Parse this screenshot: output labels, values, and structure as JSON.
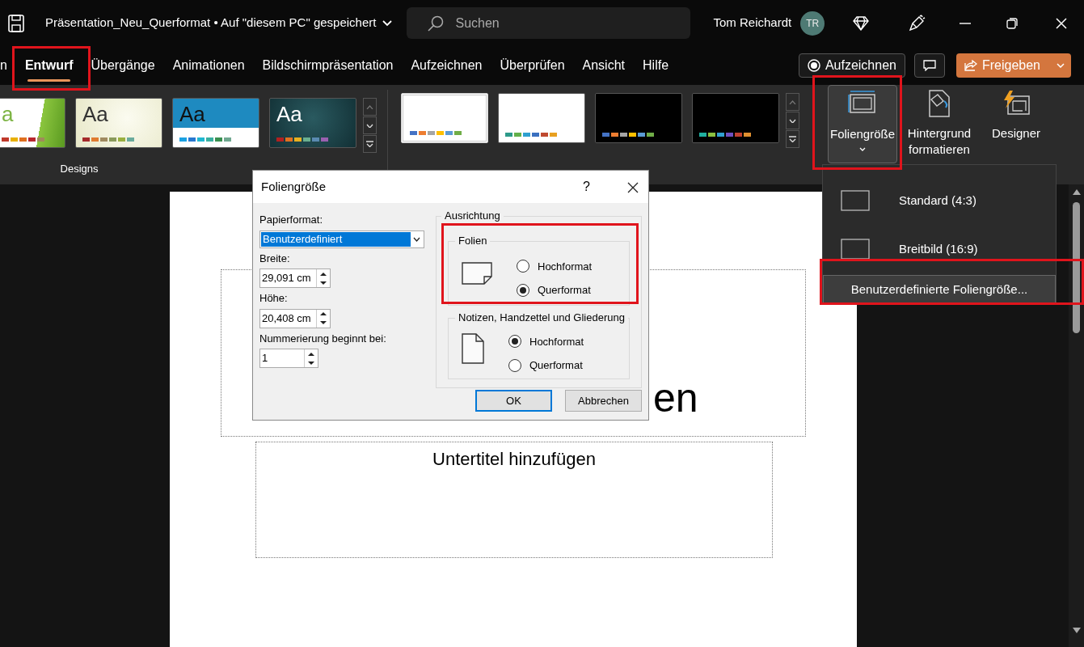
{
  "title_bar": {
    "document_title": "Präsentation_Neu_Querformat • Auf \"diesem PC\" gespeichert",
    "search_placeholder": "Suchen",
    "user_name": "Tom Reichardt",
    "avatar_initials": "TR"
  },
  "tabs": [
    {
      "label": "n",
      "selected": false
    },
    {
      "label": "Entwurf",
      "selected": true
    },
    {
      "label": "Übergänge",
      "selected": false
    },
    {
      "label": "Animationen",
      "selected": false
    },
    {
      "label": "Bildschirmpräsentation",
      "selected": false
    },
    {
      "label": "Aufzeichnen",
      "selected": false
    },
    {
      "label": "Überprüfen",
      "selected": false
    },
    {
      "label": "Ansicht",
      "selected": false
    },
    {
      "label": "Hilfe",
      "selected": false
    }
  ],
  "tab_actions": {
    "record": "Aufzeichnen",
    "share": "Freigeben"
  },
  "ribbon": {
    "designs": {
      "label": "Designs",
      "items": [
        {
          "kind": "green",
          "text": "a",
          "swatches": [
            {
              "color": "#c0392b"
            },
            {
              "color": "#e8b000"
            },
            {
              "color": "#e07020"
            },
            {
              "color": "#b8262e"
            },
            {
              "color": "#a08a5a"
            }
          ]
        },
        {
          "kind": "cream",
          "text": "Aa",
          "swatches": [
            {
              "color": "#a52a2a"
            },
            {
              "color": "#e07b30"
            },
            {
              "color": "#a08a60"
            },
            {
              "color": "#8a9a5b"
            },
            {
              "color": "#9ab040"
            },
            {
              "color": "#6aab9c"
            }
          ]
        },
        {
          "kind": "pattern",
          "text": "Aa",
          "swatches": [
            {
              "color": "#1ba1e2"
            },
            {
              "color": "#2878d0"
            },
            {
              "color": "#20b8d0"
            },
            {
              "color": "#3ab0a0"
            },
            {
              "color": "#3a9050"
            },
            {
              "color": "#70a890"
            }
          ]
        },
        {
          "kind": "teal",
          "text": "Aa",
          "swatches": [
            {
              "color": "#b02020"
            },
            {
              "color": "#e07020"
            },
            {
              "color": "#e8b020"
            },
            {
              "color": "#6ab090"
            },
            {
              "color": "#5a8ab0"
            },
            {
              "color": "#9a60b0"
            }
          ]
        }
      ]
    },
    "variants": [
      {
        "kind": "light",
        "selected": true,
        "swatches": [
          {
            "color": "#4472c4"
          },
          {
            "color": "#ed7d31"
          },
          {
            "color": "#a5a5a5"
          },
          {
            "color": "#ffc000"
          },
          {
            "color": "#5b9bd5"
          },
          {
            "color": "#70ad47"
          }
        ]
      },
      {
        "kind": "light",
        "selected": false,
        "swatches": [
          {
            "color": "#2e9a8a"
          },
          {
            "color": "#62b04a"
          },
          {
            "color": "#2ea0d0"
          },
          {
            "color": "#3a70c0"
          },
          {
            "color": "#c04a30"
          },
          {
            "color": "#e8a020"
          }
        ]
      },
      {
        "kind": "dark",
        "selected": false,
        "swatches": [
          {
            "color": "#4472c4"
          },
          {
            "color": "#ed7d31"
          },
          {
            "color": "#a5a5a5"
          },
          {
            "color": "#ffc000"
          },
          {
            "color": "#5b9bd5"
          },
          {
            "color": "#70ad47"
          }
        ]
      },
      {
        "kind": "dark",
        "selected": false,
        "swatches": [
          {
            "color": "#20b0a0"
          },
          {
            "color": "#8ac040"
          },
          {
            "color": "#30a0d0"
          },
          {
            "color": "#7050c0"
          },
          {
            "color": "#c04030"
          },
          {
            "color": "#e09030"
          }
        ]
      }
    ],
    "commands": [
      {
        "kind": "slide-size",
        "label": "Foliengröße",
        "expanded": true
      },
      {
        "kind": "background",
        "label": "Hintergrund formatieren",
        "expanded": false
      },
      {
        "kind": "designer",
        "label": "Designer",
        "expanded": false
      }
    ]
  },
  "dropdown": {
    "items": [
      {
        "kind": "shape",
        "label": "Standard (4:3)",
        "selected": false
      },
      {
        "kind": "shape",
        "label": "Breitbild (16:9)",
        "selected": false
      },
      {
        "kind": "text",
        "label": "Benutzerdefinierte Foliengröße...",
        "selected": true
      }
    ]
  },
  "slide": {
    "title_visible": "en",
    "subtitle": "Untertitel hinzufügen"
  },
  "dialog": {
    "title": "Foliengröße",
    "help": "?",
    "paper_label": "Papierformat:",
    "paper_value": "Benutzerdefiniert",
    "width_label": "Breite:",
    "width_value": "29,091 cm",
    "height_label": "Höhe:",
    "height_value": "20,408 cm",
    "numbering_label": "Nummerierung beginnt bei:",
    "numbering_value": "1",
    "orientation_label": "Ausrichtung",
    "groups": [
      {
        "label": "Folien",
        "kind": "landscape",
        "options": [
          {
            "label": "Hochformat",
            "selected": false
          },
          {
            "label": "Querformat",
            "selected": true
          }
        ]
      },
      {
        "label": "Notizen, Handzettel und Gliederung",
        "kind": "portrait",
        "options": [
          {
            "label": "Hochformat",
            "selected": true
          },
          {
            "label": "Querformat",
            "selected": false
          }
        ]
      }
    ],
    "ok": "OK",
    "cancel": "Abbrechen"
  }
}
